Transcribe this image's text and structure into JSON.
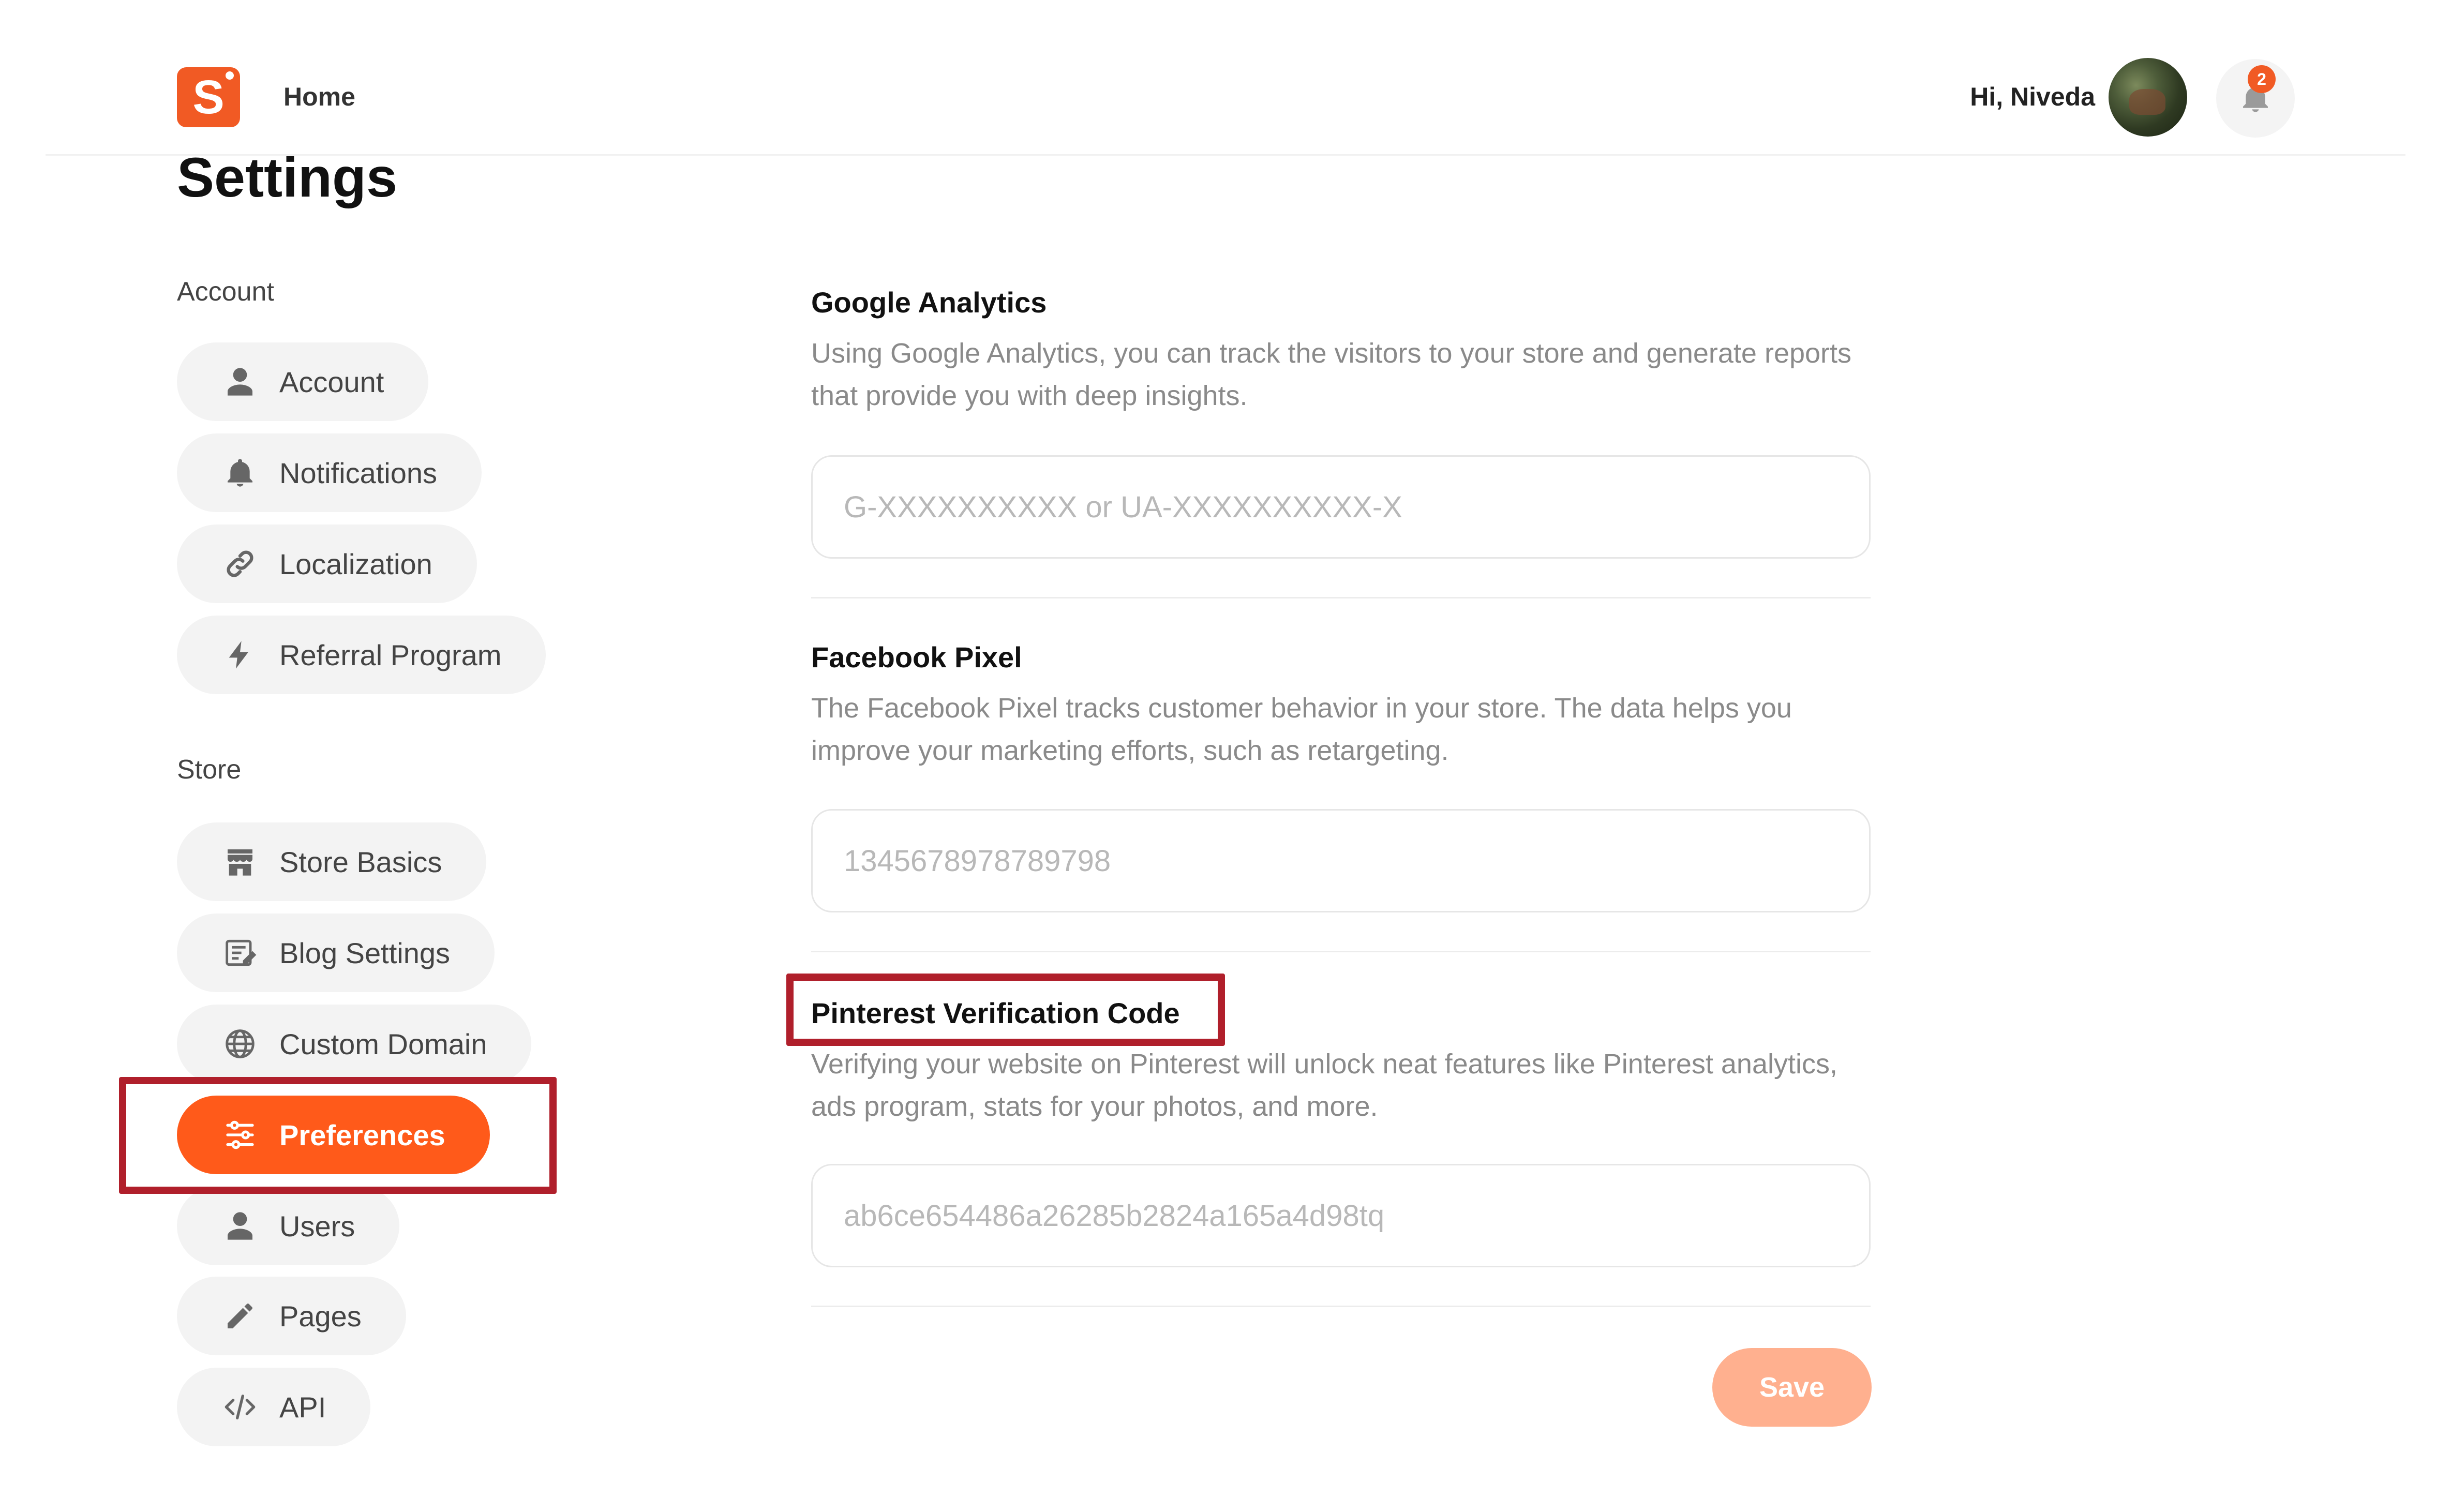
{
  "header": {
    "logo_letter": "S",
    "home_label": "Home",
    "greeting": "Hi, Niveda",
    "notification_count": "2"
  },
  "page": {
    "title": "Settings"
  },
  "sidebar": {
    "sections": [
      {
        "label": "Account",
        "items": [
          {
            "label": "Account",
            "icon": "user-icon"
          },
          {
            "label": "Notifications",
            "icon": "bell-icon"
          },
          {
            "label": "Localization",
            "icon": "link-icon"
          },
          {
            "label": "Referral Program",
            "icon": "lightning-icon"
          }
        ]
      },
      {
        "label": "Store",
        "items": [
          {
            "label": "Store Basics",
            "icon": "store-icon"
          },
          {
            "label": "Blog Settings",
            "icon": "blog-icon"
          },
          {
            "label": "Custom Domain",
            "icon": "globe-icon"
          },
          {
            "label": "Preferences",
            "icon": "sliders-icon",
            "active": true
          },
          {
            "label": "Users",
            "icon": "user-icon"
          },
          {
            "label": "Pages",
            "icon": "pencil-icon"
          },
          {
            "label": "API",
            "icon": "code-icon"
          }
        ]
      }
    ]
  },
  "main": {
    "fields": [
      {
        "title": "Google Analytics",
        "description": "Using Google Analytics, you can track the visitors to your store and generate reports that provide you with deep insights.",
        "placeholder": "G-XXXXXXXXXX or UA-XXXXXXXXXX-X",
        "value": ""
      },
      {
        "title": "Facebook Pixel",
        "description": "The Facebook Pixel tracks customer behavior in your store. The data helps you improve your marketing efforts, such as retargeting.",
        "placeholder": "1345678978789798",
        "value": ""
      },
      {
        "title": "Pinterest Verification Code",
        "description": "Verifying your website on Pinterest will unlock neat features like Pinterest analytics, ads program, stats for your photos, and more.",
        "placeholder": "ab6ce654486a26285b2824a165a4d98tq",
        "value": ""
      }
    ],
    "save_label": "Save"
  },
  "colors": {
    "accent": "#ff5a1a",
    "save_disabled": "#ffb08f",
    "highlight": "#b01f2b"
  }
}
